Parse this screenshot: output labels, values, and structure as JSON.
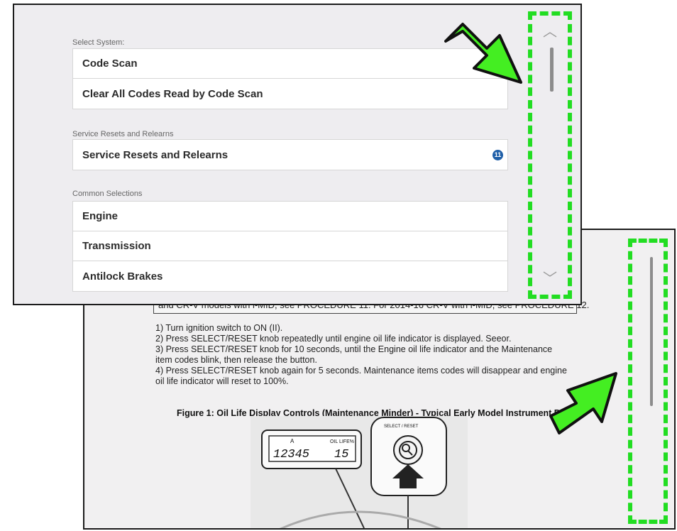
{
  "back_panel": {
    "note_line": "and CR-V models with i-MID, see PROCEDURE 11. For 2014-16 CR-V with i-MID, see PROCEDURE 12.",
    "steps": [
      "1) Turn ignition switch to ON (II).",
      "2) Press SELECT/RESET knob repeatedly until engine oil life indicator is displayed. Seeor.",
      "3) Press SELECT/RESET knob for 10 seconds, until the Engine oil life indicator and the Maintenance",
      "item codes blink, then release the button.",
      "4) Press SELECT/RESET knob again for 5 seconds. Maintenance items codes will disappear and engine",
      "oil life indicator will reset to 100%."
    ],
    "figure_caption": "Figure 1: Oil Life Display Controls (Maintenance Minder) - Typical Early Model Instrument P",
    "figure": {
      "odometer": "12345",
      "trip_marker": "A",
      "oil_life_label": "OIL LIFE%",
      "oil_life_value": "15",
      "knob_label": "SELECT / RESET"
    }
  },
  "front_panel": {
    "sections": [
      {
        "label": "Select System:",
        "items": [
          {
            "label": "Code Scan"
          },
          {
            "label": "Clear All Codes Read by Code Scan"
          }
        ]
      },
      {
        "label": "Service Resets and Relearns",
        "items": [
          {
            "label": "Service Resets and Relearns",
            "badge": "11"
          }
        ]
      },
      {
        "label": "Common Selections",
        "items": [
          {
            "label": "Engine"
          },
          {
            "label": "Transmission"
          },
          {
            "label": "Antilock Brakes"
          }
        ]
      }
    ],
    "scroll_up_icon": "chevron-up-icon",
    "scroll_down_icon": "chevron-down-icon"
  },
  "colors": {
    "highlight": "#22dd22",
    "arrow_fill": "#44ee22",
    "badge": "#1f5fa8"
  }
}
